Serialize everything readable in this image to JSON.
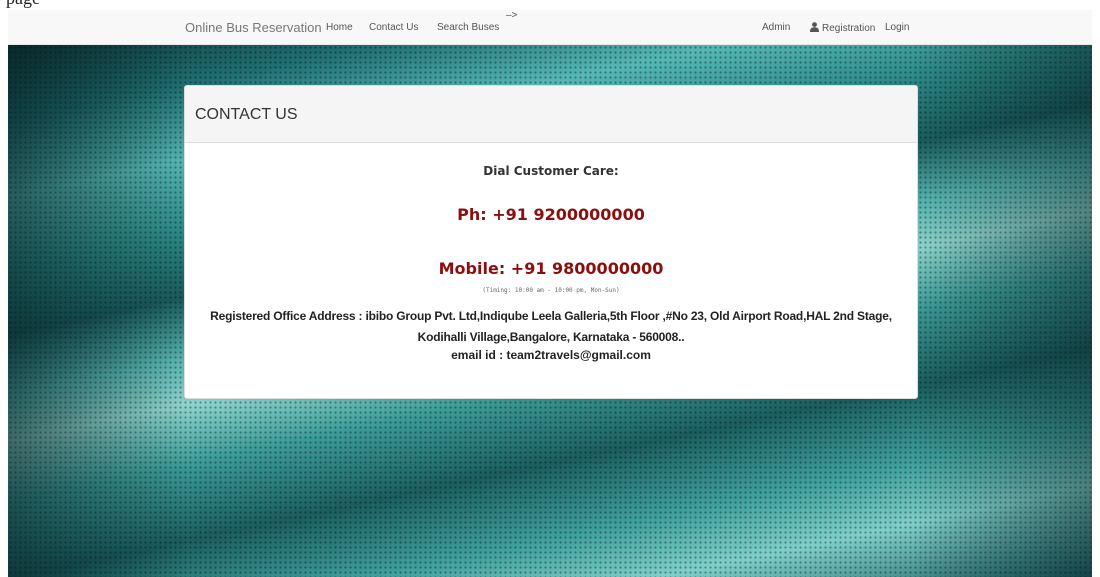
{
  "page": {
    "caption": "page"
  },
  "nav": {
    "brand": "Online Bus Reservation",
    "links": [
      "Home",
      "Contact Us",
      "Search Buses"
    ],
    "arrow": "–>",
    "right_links": [
      "Admin",
      "Registration",
      "Login"
    ],
    "icons": {
      "registration": "user-icon"
    }
  },
  "panel": {
    "title": "CONTACT US",
    "care_title": "Dial Customer Care:",
    "phone": "Ph: +91 9200000000",
    "mobile": "Mobile: +91 9800000000",
    "timing": "(Timing: 10:00 am - 10:00 pm, Mon-Sun)",
    "address_line1": "Registered Office Address : ibibo Group Pvt. Ltd,Indiqube Leela Galleria,5th Floor ,#No 23, Old Airport Road,HAL 2nd Stage,",
    "address_line2": "Kodihalli Village,Bangalore, Karnataka - 560008..",
    "email": "email id : team2travels@gmail.com"
  },
  "colors": {
    "accent": "#8b0f0f",
    "navbar_bg": "#f8f8f8",
    "panel_heading_bg": "#f5f5f5",
    "hero_teal": "#2a8784"
  }
}
